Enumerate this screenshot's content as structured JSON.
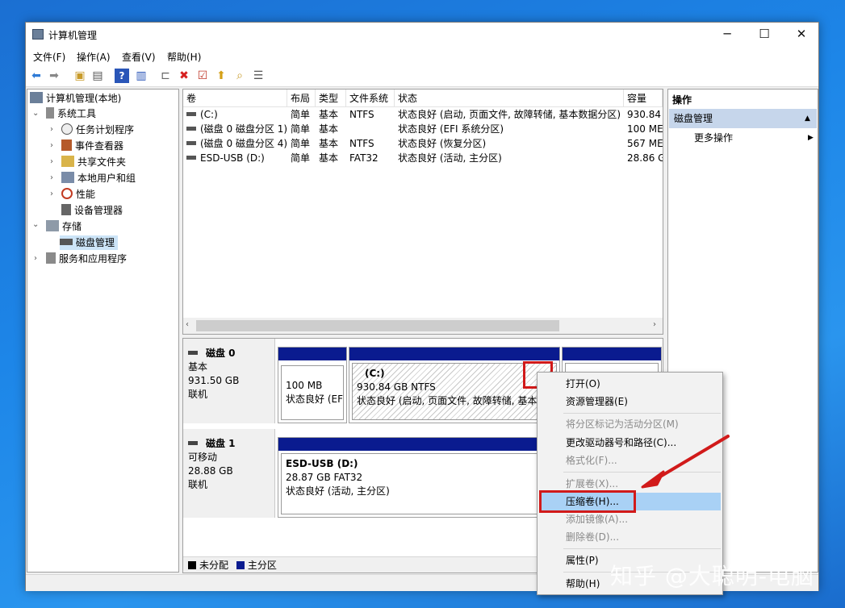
{
  "window": {
    "title": "计算机管理"
  },
  "menu": [
    "文件(F)",
    "操作(A)",
    "查看(V)",
    "帮助(H)"
  ],
  "tree": {
    "root": "计算机管理(本地)",
    "system_tools": "系统工具",
    "task_scheduler": "任务计划程序",
    "event_viewer": "事件查看器",
    "shared_folders": "共享文件夹",
    "local_users": "本地用户和组",
    "performance": "性能",
    "device_manager": "设备管理器",
    "storage": "存储",
    "disk_management": "磁盘管理",
    "services": "服务和应用程序"
  },
  "volumes": {
    "columns": [
      "卷",
      "布局",
      "类型",
      "文件系统",
      "状态",
      "容量"
    ],
    "rows": [
      [
        "(C:)",
        "简单",
        "基本",
        "NTFS",
        "状态良好 (启动, 页面文件, 故障转储, 基本数据分区)",
        "930.84"
      ],
      [
        "(磁盘 0 磁盘分区 1)",
        "简单",
        "基本",
        "",
        "状态良好 (EFI 系统分区)",
        "100 ME"
      ],
      [
        "(磁盘 0 磁盘分区 4)",
        "简单",
        "基本",
        "NTFS",
        "状态良好 (恢复分区)",
        "567 ME"
      ],
      [
        "ESD-USB (D:)",
        "简单",
        "基本",
        "FAT32",
        "状态良好 (活动, 主分区)",
        "28.86 G"
      ]
    ]
  },
  "disk0": {
    "name": "磁盘 0",
    "type": "基本",
    "size": "931.50 GB",
    "status": "联机",
    "p1": {
      "size": "100 MB",
      "status": "状态良好 (EFI"
    },
    "p2": {
      "name": "(C:)",
      "size": "930.84 GB NTFS",
      "status": "状态良好 (启动, 页面文件, 故障转储, 基本数"
    }
  },
  "disk1": {
    "name": "磁盘 1",
    "type": "可移动",
    "size": "28.88 GB",
    "status": "联机",
    "p1": {
      "name": "ESD-USB  (D:)",
      "size": "28.87 GB FAT32",
      "status": "状态良好 (活动, 主分区)"
    }
  },
  "legend": {
    "unallocated": "未分配",
    "primary": "主分区",
    "unallocated_color": "#000000",
    "primary_color": "#0a1b8f"
  },
  "actions": {
    "header": "操作",
    "section": "磁盘管理",
    "more": "更多操作"
  },
  "context_menu": {
    "open": "打开(O)",
    "explorer": "资源管理器(E)",
    "mark_active": "将分区标记为活动分区(M)",
    "change_letter": "更改驱动器号和路径(C)...",
    "format": "格式化(F)...",
    "extend": "扩展卷(X)...",
    "shrink": "压缩卷(H)...",
    "add_mirror": "添加镜像(A)...",
    "delete": "删除卷(D)...",
    "properties": "属性(P)",
    "help": "帮助(H)"
  },
  "watermark": "知乎 @大聪明-电脑",
  "colors": {
    "highlight": "#a9d1f5",
    "red_annotation": "#d11a1a",
    "selected_section": "#c6d6eb"
  }
}
